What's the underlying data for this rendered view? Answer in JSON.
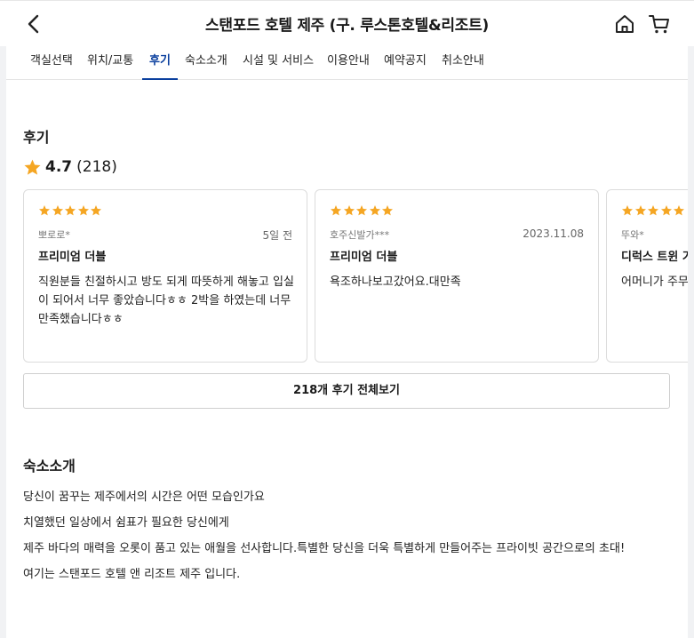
{
  "header": {
    "title": "스탠포드 호텔 제주 (구. 루스톤호텔&리조트)"
  },
  "tabs": [
    {
      "label": "객실선택",
      "active": false
    },
    {
      "label": "위치/교통",
      "active": false
    },
    {
      "label": "후기",
      "active": true
    },
    {
      "label": "숙소소개",
      "active": false
    },
    {
      "label": "시설 및 서비스",
      "active": false
    },
    {
      "label": "이용안내",
      "active": false
    },
    {
      "label": "예약공지",
      "active": false
    },
    {
      "label": "취소안내",
      "active": false
    }
  ],
  "reviews": {
    "heading": "후기",
    "rating": "4.7",
    "count": "(218)",
    "star_color": "#f5a623",
    "items": [
      {
        "stars": 5,
        "reviewer": "뽀로로*",
        "date": "5일 전",
        "room": "프리미엄 더블",
        "text": "직원분들 친절하시고 방도 되게 따뜻하게 해놓고 입실이 되어서 너무 좋았습니다ㅎㅎ 2박을 하였는데 너무 만족했습니다ㅎㅎ"
      },
      {
        "stars": 5,
        "reviewer": "호주신발가***",
        "date": "2023.11.08",
        "room": "프리미엄 더블",
        "text": "욕조하나보고갔어요.대만족"
      },
      {
        "stars": 5,
        "reviewer": "뚜와*",
        "date": "",
        "room": "디럭스 트윈 가든뷰",
        "text": "어머니가 주무시기 좋았다고 합니다"
      }
    ],
    "view_all_label": "218개 후기 전체보기"
  },
  "intro": {
    "heading": "숙소소개",
    "lines": [
      "당신이 꿈꾸는 제주에서의 시간은 어떤 모습인가요",
      "치열했던 일상에서 쉼표가 필요한 당신에게",
      "제주 바다의 매력을 오롯이 품고 있는 애월을 선사합니다.특별한 당신을 더욱 특별하게 만들어주는 프라이빗 공간으로의 초대!",
      "여기는 스탠포드 호텔 앤 리조트 제주 입니다."
    ]
  },
  "colors": {
    "accent": "#0a3f9e",
    "star": "#f5a623"
  }
}
